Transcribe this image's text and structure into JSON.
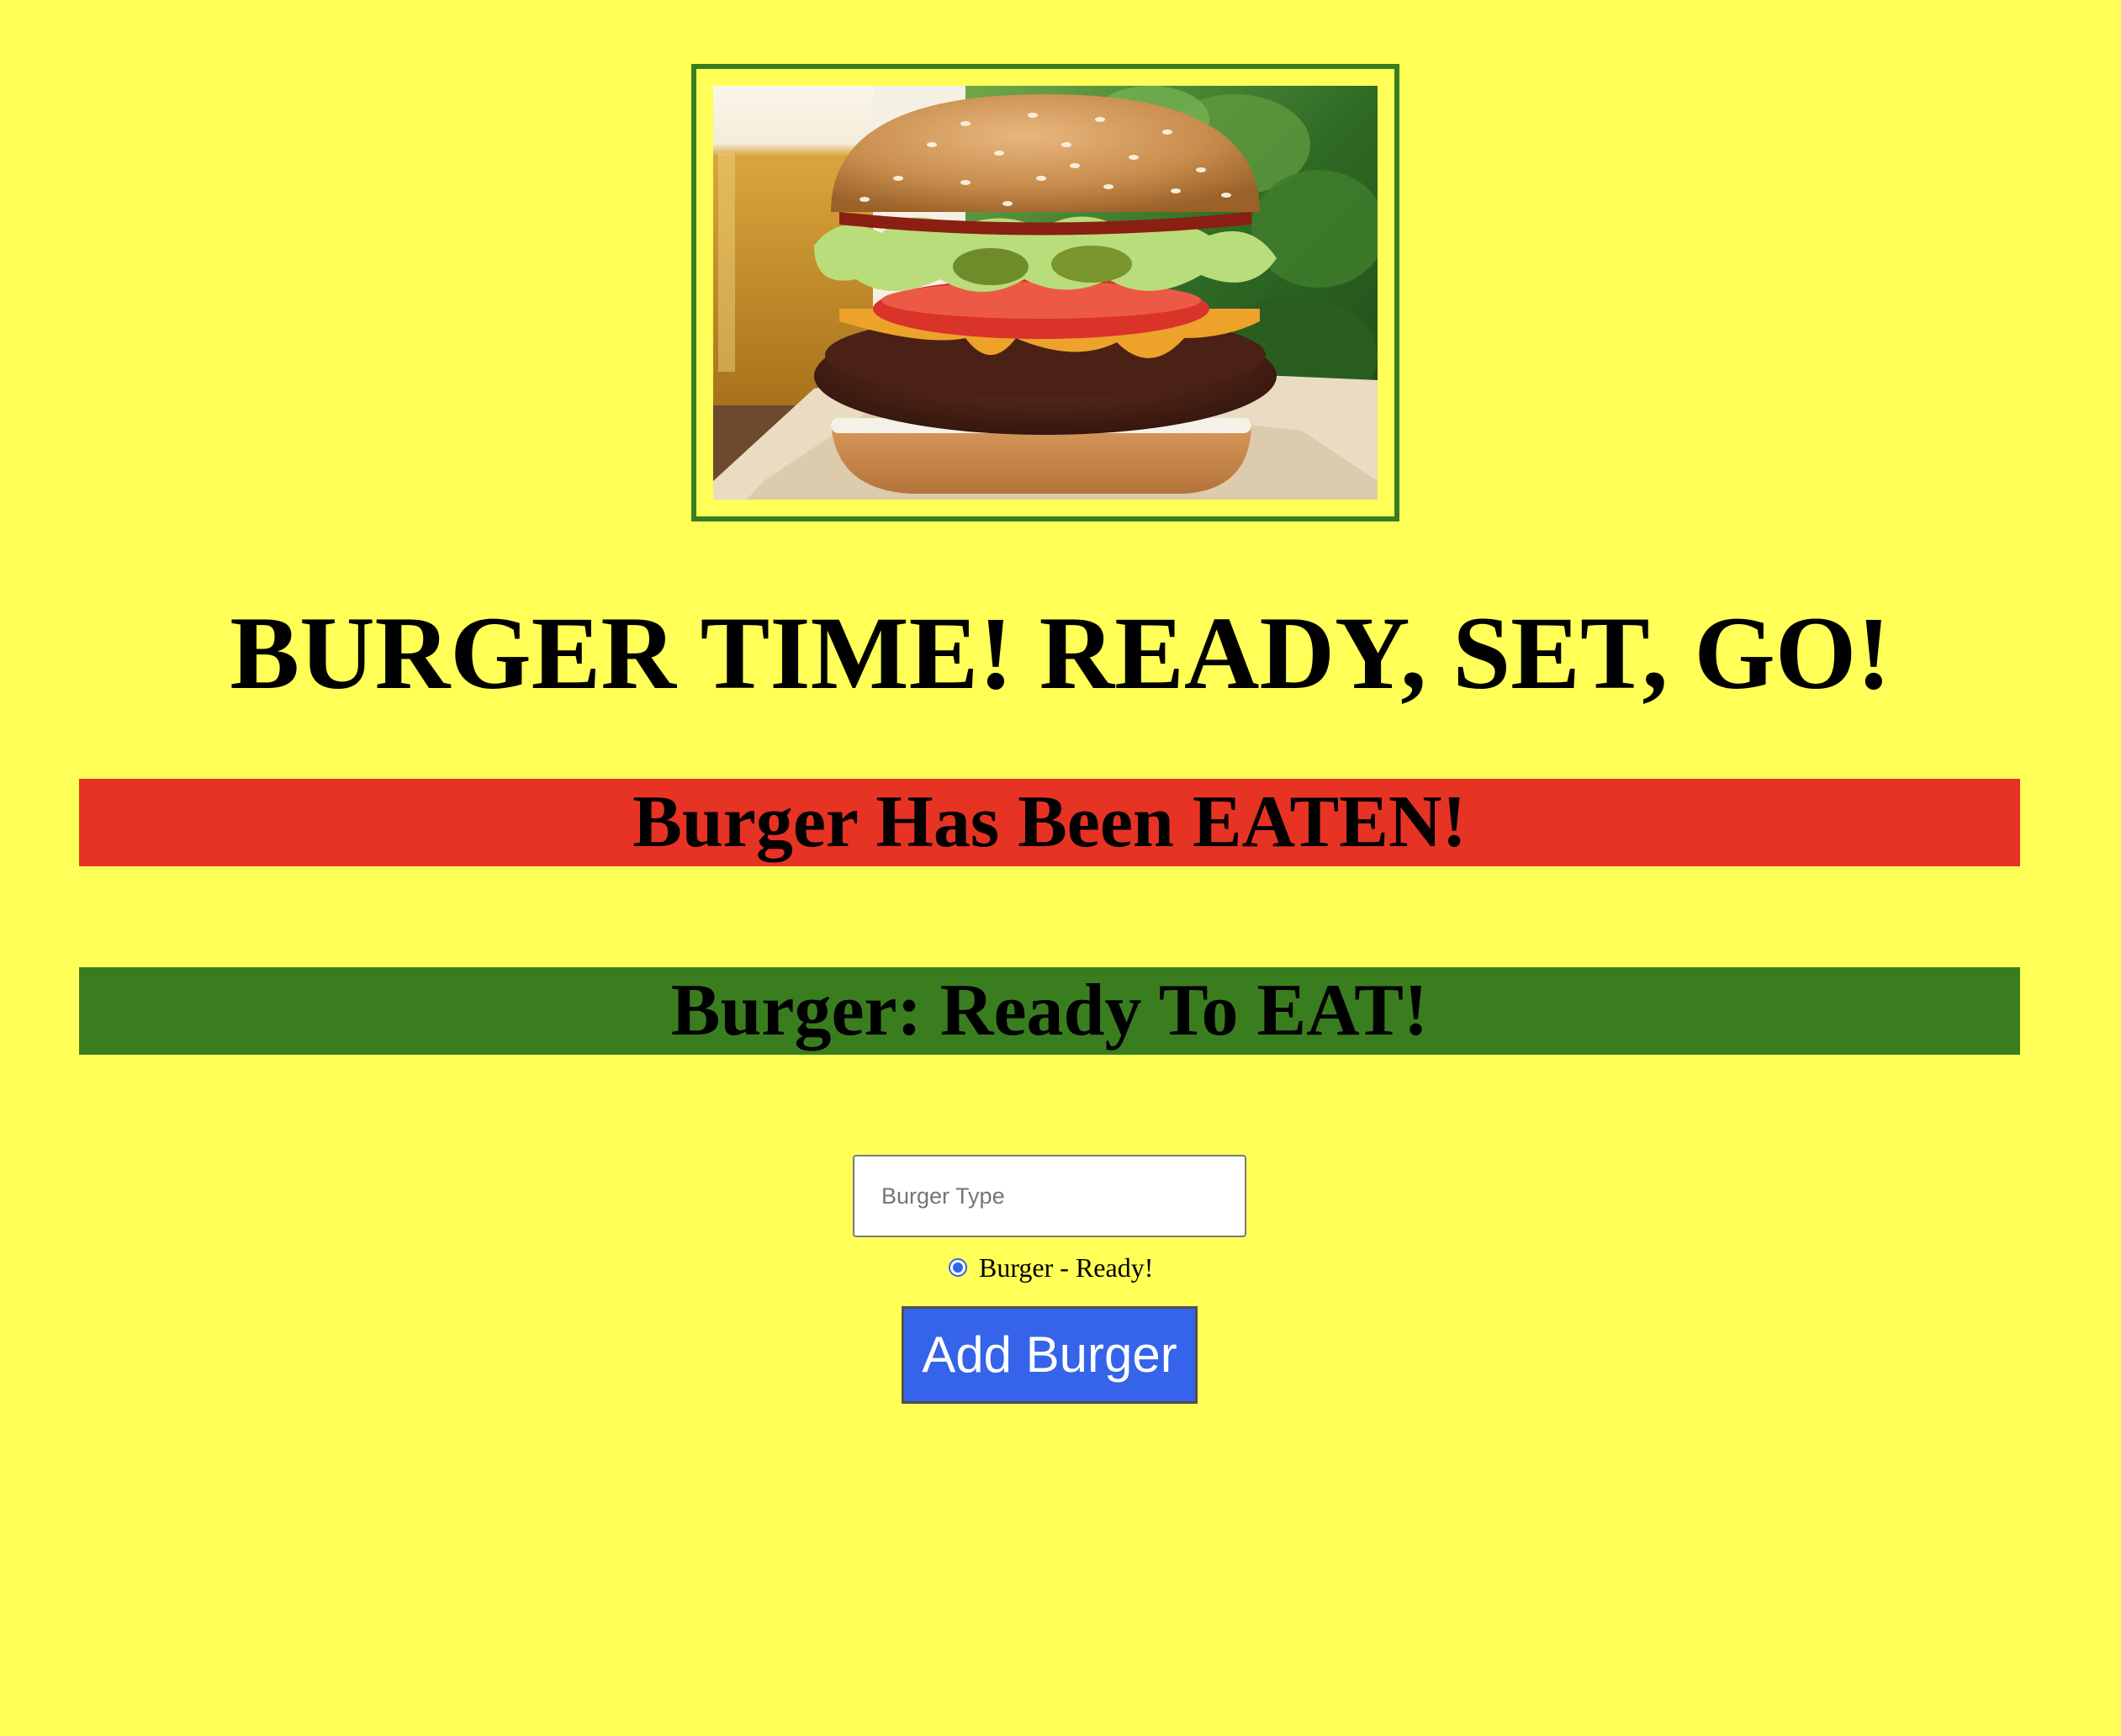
{
  "hero": {
    "image_alt": "Cheeseburger with lettuce, tomato, pickles and a glass of beer",
    "frame_color": "#3a7d1f"
  },
  "page": {
    "title": "BURGER TIME! READY, SET, GO!",
    "background_color": "#ffff57"
  },
  "sections": {
    "eaten_heading": "Burger Has Been EATEN!",
    "eaten_color": "#e63324",
    "ready_heading": "Burger: Ready To EAT!",
    "ready_color": "#3a7d1f"
  },
  "form": {
    "input_placeholder": "Burger Type",
    "input_value": "",
    "radio_label": "Burger - Ready!",
    "radio_checked": true,
    "submit_label": "Add Burger",
    "button_color": "#3563e9"
  }
}
